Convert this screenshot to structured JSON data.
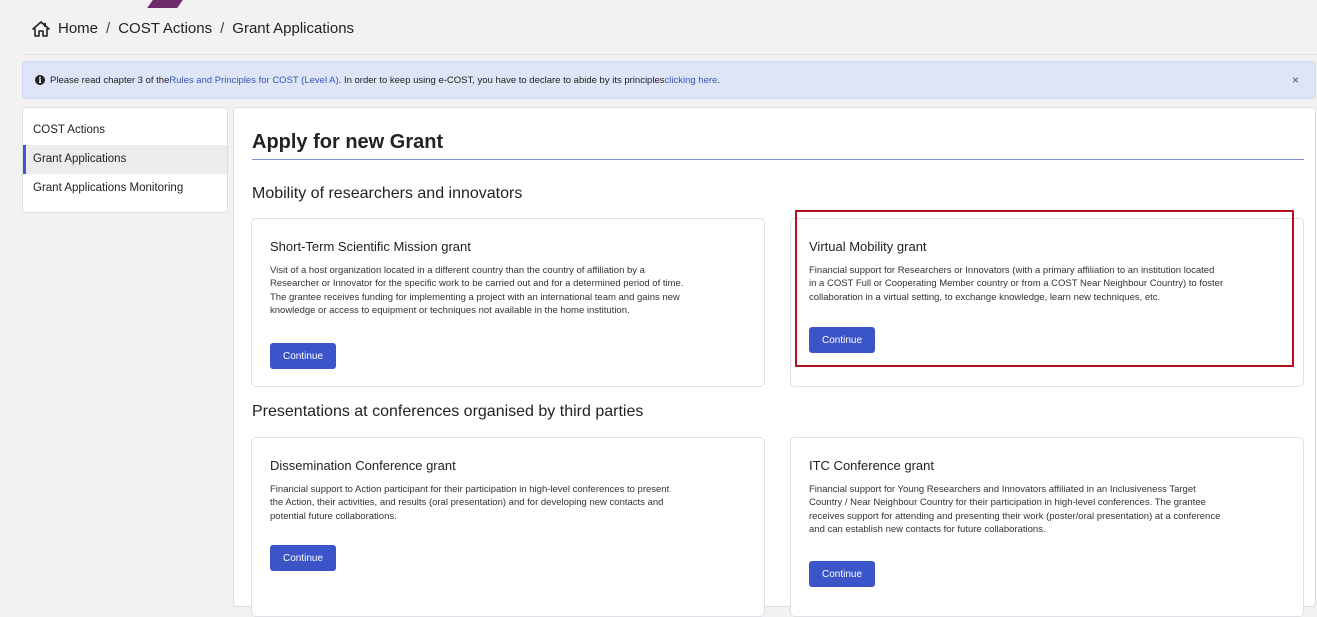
{
  "breadcrumb": {
    "items": [
      "Home",
      "COST Actions",
      "Grant Applications"
    ],
    "separator": "/"
  },
  "alert": {
    "text_1": "Please read chapter 3 of the ",
    "link_1": "Rules and Principles for COST (Level A)",
    "text_2": ". In order to keep using e-COST, you have to declare to abide by its principles ",
    "link_2": "clicking here",
    "text_3": ".",
    "close": "×"
  },
  "sidebar": {
    "items": [
      {
        "label": "COST Actions"
      },
      {
        "label": "Grant Applications"
      },
      {
        "label": "Grant Applications Monitoring"
      }
    ]
  },
  "main": {
    "title": "Apply for new Grant",
    "sections": [
      {
        "title": "Mobility of researchers and innovators",
        "cards": [
          {
            "title": "Short-Term Scientific Mission grant",
            "lines": [
              "Visit of a host organization located in a different country than the country of affiliation by a",
              "Researcher or Innovator for the specific work to be carried out and for a determined period of time.",
              "The grantee receives funding for implementing a project with an international team and gains new",
              "knowledge or access to equipment or techniques not available in the home institution."
            ],
            "button": "Continue"
          },
          {
            "title": "Virtual Mobility grant",
            "lines": [
              "Financial support for Researchers or Innovators (with a primary affiliation to an institution located",
              "in a COST Full or Cooperating Member country or from a COST Near Neighbour Country) to foster",
              "collaboration in a virtual setting, to exchange knowledge, learn new techniques, etc."
            ],
            "button": "Continue"
          }
        ]
      },
      {
        "title": "Presentations at conferences organised by third parties",
        "cards": [
          {
            "title": "Dissemination Conference grant",
            "lines": [
              "Financial support to Action participant for their participation in high-level conferences to present",
              "the Action, their activities, and results (oral presentation) and for developing new contacts and",
              "potential future collaborations."
            ],
            "button": "Continue"
          },
          {
            "title": "ITC Conference grant",
            "lines": [
              "Financial support for Young Researchers and Innovators affiliated in an Inclusiveness Target",
              "Country / Near Neighbour Country for their participation in high-level conferences. The grantee",
              "receives support for attending and presenting their work (poster/oral presentation) at a conference",
              "and can establish new contacts for future collaborations."
            ],
            "button": "Continue"
          }
        ]
      }
    ]
  },
  "colors": {
    "accent": "#3b55c9",
    "alert_bg": "#dde5f6",
    "highlight": "#b40f1a"
  },
  "icons": {
    "home": "home-icon",
    "info": "info-icon",
    "close": "close-icon"
  }
}
